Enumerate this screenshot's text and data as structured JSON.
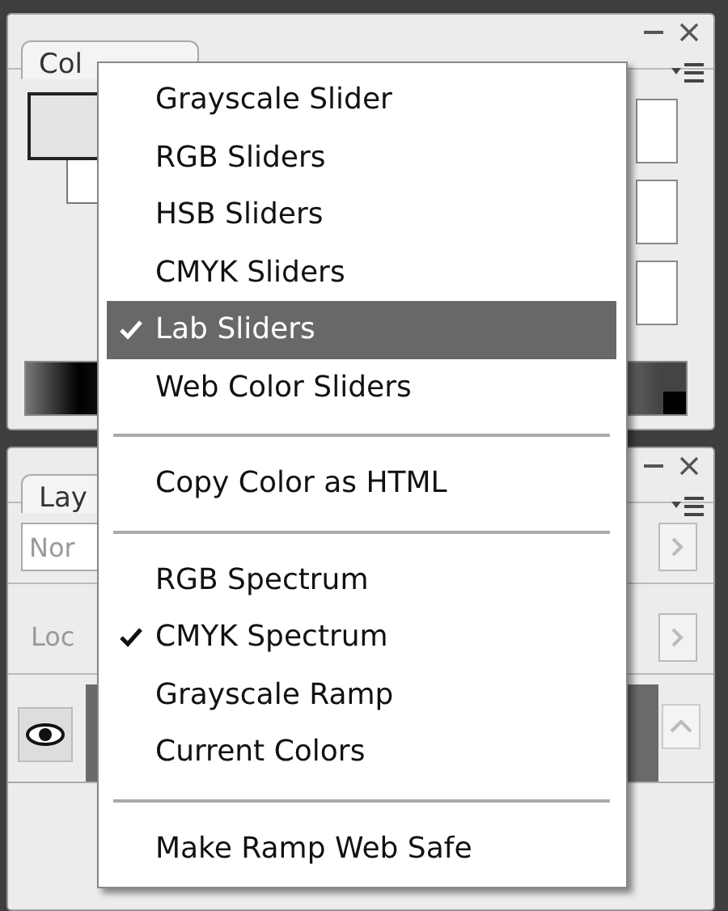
{
  "color_panel": {
    "tab": {
      "label": "Col",
      "selected": true
    }
  },
  "layers_panel": {
    "tab": {
      "label": "Lay",
      "selected": true
    },
    "blend_mode": {
      "value": "Nor"
    },
    "lock_label": "Loc"
  },
  "menu": {
    "items": [
      {
        "kind": "item",
        "label": "Grayscale Slider",
        "checked": false,
        "selected": false
      },
      {
        "kind": "item",
        "label": "RGB Sliders",
        "checked": false,
        "selected": false
      },
      {
        "kind": "item",
        "label": "HSB Sliders",
        "checked": false,
        "selected": false
      },
      {
        "kind": "item",
        "label": "CMYK Sliders",
        "checked": false,
        "selected": false
      },
      {
        "kind": "item",
        "label": "Lab Sliders",
        "checked": true,
        "selected": true
      },
      {
        "kind": "item",
        "label": "Web Color Sliders",
        "checked": false,
        "selected": false
      },
      {
        "kind": "separator"
      },
      {
        "kind": "item",
        "label": "Copy Color as HTML",
        "checked": false,
        "selected": false
      },
      {
        "kind": "separator"
      },
      {
        "kind": "item",
        "label": "RGB Spectrum",
        "checked": false,
        "selected": false
      },
      {
        "kind": "item",
        "label": "CMYK Spectrum",
        "checked": true,
        "selected": false
      },
      {
        "kind": "item",
        "label": "Grayscale Ramp",
        "checked": false,
        "selected": false
      },
      {
        "kind": "item",
        "label": "Current Colors",
        "checked": false,
        "selected": false
      },
      {
        "kind": "separator"
      },
      {
        "kind": "item",
        "label": "Make Ramp Web Safe",
        "checked": false,
        "selected": false
      }
    ]
  }
}
